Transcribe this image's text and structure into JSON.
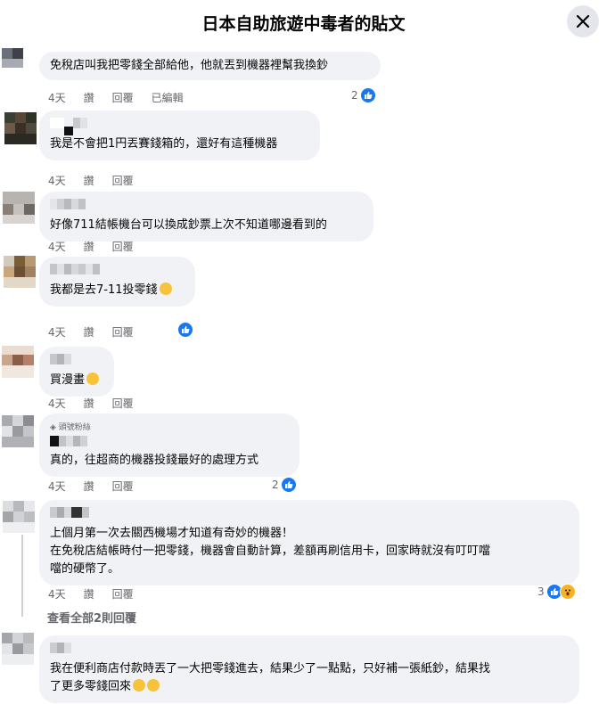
{
  "header": {
    "title": "日本自助旅遊中毒者的貼文"
  },
  "comments": [
    {
      "text": "免稅店叫我把零錢全部給他，他就丟到機器裡幫我換鈔",
      "time": "4天",
      "like_label": "讚",
      "reply_label": "回覆",
      "edited": "已編輯",
      "reactions": "2"
    },
    {
      "text": "我是不會把1円丟賽錢箱的，還好有這種機器",
      "time": "4天",
      "like_label": "讚",
      "reply_label": "回覆"
    },
    {
      "text": "好像711結帳機台可以換成鈔票上次不知道哪邊看到的",
      "time": "4天",
      "like_label": "讚",
      "reply_label": "回覆"
    },
    {
      "text": "我都是去7-11投零錢",
      "time": "4天",
      "like_label": "讚",
      "reply_label": "回覆"
    },
    {
      "text": "買漫畫",
      "time": "4天",
      "like_label": "讚",
      "reply_label": "回覆"
    },
    {
      "badge": "頭號粉絲",
      "text": "真的，往超商的機器投錢最好的處理方式",
      "time": "4天",
      "like_label": "讚",
      "reply_label": "回覆",
      "reactions": "2"
    },
    {
      "text": "上個月第一次去關西機場才知道有奇妙的機器！\n在免稅店結帳時付一把零錢，機器會自動計算，差額再刷信用卡，回家時就沒有叮叮噹\n噹的硬幣了。",
      "time": "4天",
      "like_label": "讚",
      "reply_label": "回覆",
      "reactions": "3"
    },
    {
      "text": "我在便利商店付款時丟了一大把零錢進去，結果少了一點點，只好補一張紙鈔，結果找\n了更多零錢回來",
      "time": "",
      "like_label": "",
      "reply_label": ""
    }
  ],
  "view_replies": "查看全部2則回覆",
  "colors": {
    "like_blue": "#1877f2",
    "bubble": "#f0f2f5",
    "meta": "#65676b"
  }
}
